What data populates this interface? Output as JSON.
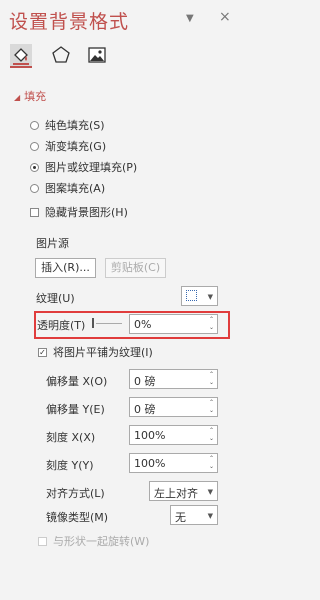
{
  "pane": {
    "title": "设置背景格式"
  },
  "header_icons": {
    "pin": "pin-down-icon",
    "close": "close-icon"
  },
  "tabs": [
    {
      "icon": "fill-bucket-icon",
      "active": true
    },
    {
      "icon": "pentagon-effects-icon",
      "active": false
    },
    {
      "icon": "picture-icon",
      "active": false
    }
  ],
  "fill_section": {
    "label": "填充",
    "options": [
      {
        "label": "纯色填充(S)",
        "selected": false
      },
      {
        "label": "渐变填充(G)",
        "selected": false
      },
      {
        "label": "图片或纹理填充(P)",
        "selected": true
      },
      {
        "label": "图案填充(A)",
        "selected": false
      }
    ],
    "hide_bg_label": "隐藏背景图形(H)",
    "picture_source_label": "图片源",
    "insert_btn": "插入(R)...",
    "clipboard_btn": "剪贴板(C)",
    "texture_label": "纹理(U)",
    "transparency_label": "透明度(T)",
    "transparency_value": "0%",
    "transparency_level": 0,
    "tile_label": "将图片平铺为纹理(I)",
    "tile_checked": true,
    "offset_x_label": "偏移量 X(O)",
    "offset_x_value": "0 磅",
    "offset_y_label": "偏移量 Y(E)",
    "offset_y_value": "0 磅",
    "scale_x_label": "刻度 X(X)",
    "scale_x_value": "100%",
    "scale_y_label": "刻度 Y(Y)",
    "scale_y_value": "100%",
    "align_label": "对齐方式(L)",
    "align_value": "左上对齐",
    "mirror_label": "镜像类型(M)",
    "mirror_value": "无",
    "rotate_label": "与形状一起旋转(W)"
  },
  "colors": {
    "accent": "#c0504d",
    "highlight_border": "#e03c3c"
  }
}
